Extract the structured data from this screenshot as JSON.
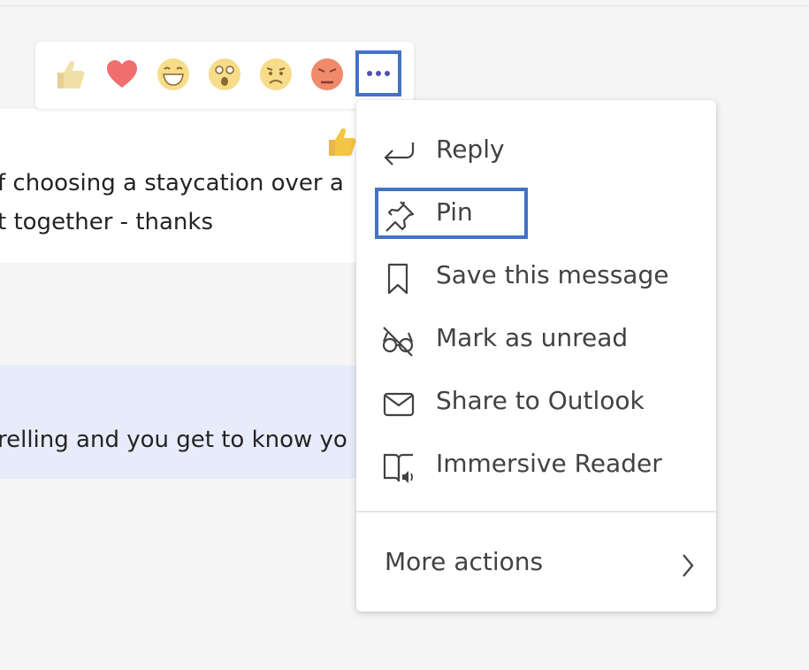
{
  "message_1": {
    "line_1": "f choosing a staycation over a",
    "line_2": "t together - thanks"
  },
  "message_2": {
    "line_1": "relling and you get to know yo"
  },
  "reaction_bar": {
    "reactions": [
      "like",
      "heart",
      "laugh",
      "surprised",
      "sad",
      "angry"
    ],
    "more_options_label": "More options"
  },
  "menu": {
    "items": [
      {
        "label": "Reply",
        "icon": "reply-icon"
      },
      {
        "label": "Pin",
        "icon": "pin-icon"
      },
      {
        "label": "Save this message",
        "icon": "bookmark-icon"
      },
      {
        "label": "Mark as unread",
        "icon": "unread-glasses-icon"
      },
      {
        "label": "Share to Outlook",
        "icon": "mail-icon"
      },
      {
        "label": "Immersive Reader",
        "icon": "immersive-reader-icon"
      }
    ],
    "more_actions": "More actions"
  },
  "colors": {
    "highlight_border": "#4472c4",
    "accent": "#4f52b2",
    "highlighted_message_bg": "#e8ebfa"
  }
}
